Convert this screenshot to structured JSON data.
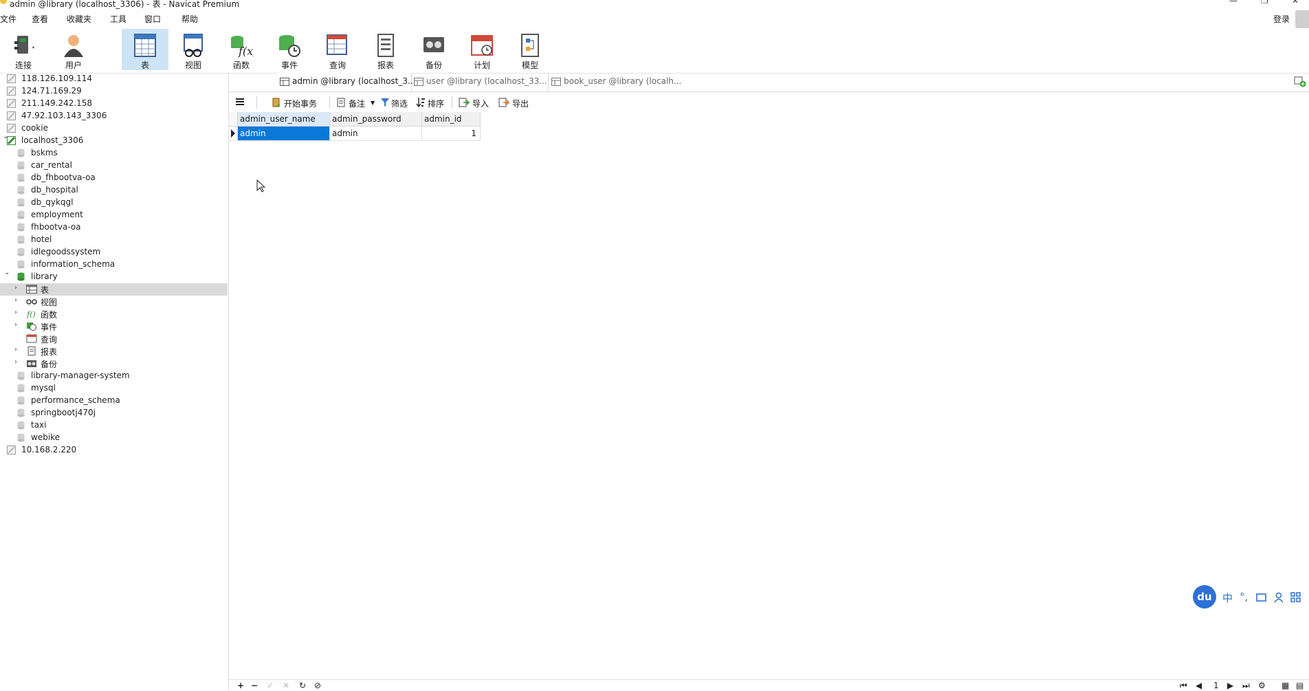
{
  "window": {
    "title": "admin @library (localhost_3306) - 表 - Navicat Premium",
    "min": "—",
    "max": "❐",
    "close": "✕"
  },
  "menu": [
    "文件",
    "查看",
    "收藏夹",
    "工具",
    "窗口",
    "帮助"
  ],
  "login_label": "登录",
  "toolbar": [
    {
      "label": "连接",
      "icon": "plug-icon"
    },
    {
      "label": "用户",
      "icon": "user-icon"
    },
    {
      "label": "表",
      "icon": "table-icon",
      "active": true
    },
    {
      "label": "视图",
      "icon": "view-icon"
    },
    {
      "label": "函数",
      "icon": "function-icon"
    },
    {
      "label": "事件",
      "icon": "event-icon"
    },
    {
      "label": "查询",
      "icon": "query-icon"
    },
    {
      "label": "报表",
      "icon": "report-icon"
    },
    {
      "label": "备份",
      "icon": "backup-icon"
    },
    {
      "label": "计划",
      "icon": "schedule-icon"
    },
    {
      "label": "模型",
      "icon": "model-icon"
    }
  ],
  "tree": [
    {
      "label": "118.126.109.114",
      "type": "server"
    },
    {
      "label": "124.71.169.29",
      "type": "server"
    },
    {
      "label": "211.149.242.158",
      "type": "server"
    },
    {
      "label": "47.92.103.143_3306",
      "type": "server"
    },
    {
      "label": "cookie",
      "type": "server"
    },
    {
      "label": "localhost_3306",
      "type": "server-open"
    },
    {
      "label": "bskms",
      "type": "db"
    },
    {
      "label": "car_rental",
      "type": "db"
    },
    {
      "label": "db_fhbootva-oa",
      "type": "db"
    },
    {
      "label": "db_hospital",
      "type": "db"
    },
    {
      "label": "db_qykqgl",
      "type": "db"
    },
    {
      "label": "employment",
      "type": "db"
    },
    {
      "label": "fhbootva-oa",
      "type": "db"
    },
    {
      "label": "hotel",
      "type": "db"
    },
    {
      "label": "idlegoodssystem",
      "type": "db"
    },
    {
      "label": "information_schema",
      "type": "db"
    },
    {
      "label": "library",
      "type": "db-open"
    },
    {
      "label": "表",
      "type": "tables",
      "selected": true
    },
    {
      "label": "视图",
      "type": "views"
    },
    {
      "label": "函数",
      "type": "functions"
    },
    {
      "label": "事件",
      "type": "events"
    },
    {
      "label": "查询",
      "type": "queries"
    },
    {
      "label": "报表",
      "type": "reports"
    },
    {
      "label": "备份",
      "type": "backups"
    },
    {
      "label": "library-manager-system",
      "type": "db"
    },
    {
      "label": "mysql",
      "type": "db"
    },
    {
      "label": "performance_schema",
      "type": "db"
    },
    {
      "label": "springbootj470j",
      "type": "db"
    },
    {
      "label": "taxi",
      "type": "db"
    },
    {
      "label": "webike",
      "type": "db"
    },
    {
      "label": "10.168.2.220",
      "type": "server-alt"
    }
  ],
  "tabs": [
    {
      "label": "admin @library (localhost_3...",
      "active": true
    },
    {
      "label": "user @library (localhost_33..."
    },
    {
      "label": "book_user @library (localh..."
    }
  ],
  "data_toolbar": {
    "begin_tx": "开始事务",
    "memo": "备注",
    "filter": "筛选",
    "sort": "排序",
    "import": "导入",
    "export": "导出"
  },
  "table": {
    "columns": [
      "admin_user_name",
      "admin_password",
      "admin_id"
    ],
    "rows": [
      [
        "admin",
        "admin",
        "1"
      ]
    ]
  },
  "pager": {
    "page": "1"
  },
  "ime": {
    "logo": "du",
    "mode": "中",
    "punct": "°,"
  }
}
